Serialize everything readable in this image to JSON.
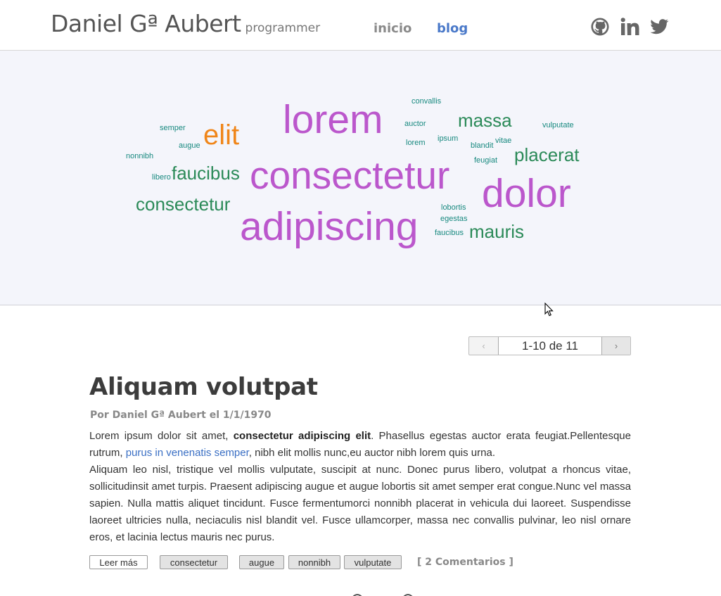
{
  "header": {
    "brand_name": "Daniel Gª Aubert",
    "brand_sub": "programmer",
    "nav": {
      "inicio": "inicio",
      "blog": "blog"
    },
    "social_icons": [
      "github-icon",
      "linkedin-icon",
      "twitter-icon"
    ],
    "colors": {
      "nav_active": "#4a79c9",
      "nav_inactive": "#8a8a8a"
    }
  },
  "word_cloud": {
    "background": "#f4f5fb",
    "words": [
      {
        "text": "lorem",
        "color": "purple"
      },
      {
        "text": "consectetur",
        "color": "purple"
      },
      {
        "text": "dolor",
        "color": "purple"
      },
      {
        "text": "adipiscing",
        "color": "purple"
      },
      {
        "text": "elit",
        "color": "orange"
      },
      {
        "text": "faucibus",
        "color": "green"
      },
      {
        "text": "consectetur",
        "color": "green"
      },
      {
        "text": "massa",
        "color": "green"
      },
      {
        "text": "placerat",
        "color": "green"
      },
      {
        "text": "mauris",
        "color": "green"
      },
      {
        "text": "convallis",
        "color": "teal"
      },
      {
        "text": "auctor",
        "color": "teal"
      },
      {
        "text": "ipsum",
        "color": "teal"
      },
      {
        "text": "lorem",
        "color": "teal"
      },
      {
        "text": "blandit",
        "color": "teal"
      },
      {
        "text": "vitae",
        "color": "teal"
      },
      {
        "text": "feugiat",
        "color": "teal"
      },
      {
        "text": "vulputate",
        "color": "teal"
      },
      {
        "text": "semper",
        "color": "teal"
      },
      {
        "text": "augue",
        "color": "teal"
      },
      {
        "text": "nonnibh",
        "color": "teal"
      },
      {
        "text": "libero",
        "color": "teal"
      },
      {
        "text": "lobortis",
        "color": "teal"
      },
      {
        "text": "egestas",
        "color": "teal"
      },
      {
        "text": "faucibus",
        "color": "teal"
      }
    ]
  },
  "pagination": {
    "prev": "‹",
    "label": "1-10 de 11",
    "next": "›"
  },
  "post": {
    "title": "Aliquam volutpat",
    "meta": "Por Daniel Gª Aubert el 1/1/1970",
    "p1_a": "Lorem ipsum dolor sit amet, ",
    "p1_bold": "consectetur adipiscing elit",
    "p1_b": ". Phasellus egestas auctor erata feugiat.Pellentesque rutrum, ",
    "p1_link": "purus in venenatis semper",
    "p1_c": ", nibh elit mollis nunc,eu auctor nibh lorem quis urna.",
    "p2": "Aliquam leo nisl, tristique vel mollis vulputate, suscipit at nunc. Donec purus libero, volutpat a rhoncus vitae, sollicitudinsit amet turpis. Praesent adipiscing augue et augue lobortis sit amet semper erat congue.Nunc vel massa sapien. Nulla mattis aliquet tincidunt. Fusce fermentumorci nonnibh placerat in vehicula dui laoreet. Suspendisse laoreet ultricies nulla, neciaculis nisl blandit vel. Fusce ullamcorper, massa nec convallis pulvinar, leo nisl ornare eros, et lacinia lectus mauris nec purus.",
    "read_more": "Leer más",
    "tags": [
      "consectetur",
      "augue",
      "nonnibh",
      "vulputate"
    ],
    "comments": "[ 2 Comentarios ]"
  }
}
